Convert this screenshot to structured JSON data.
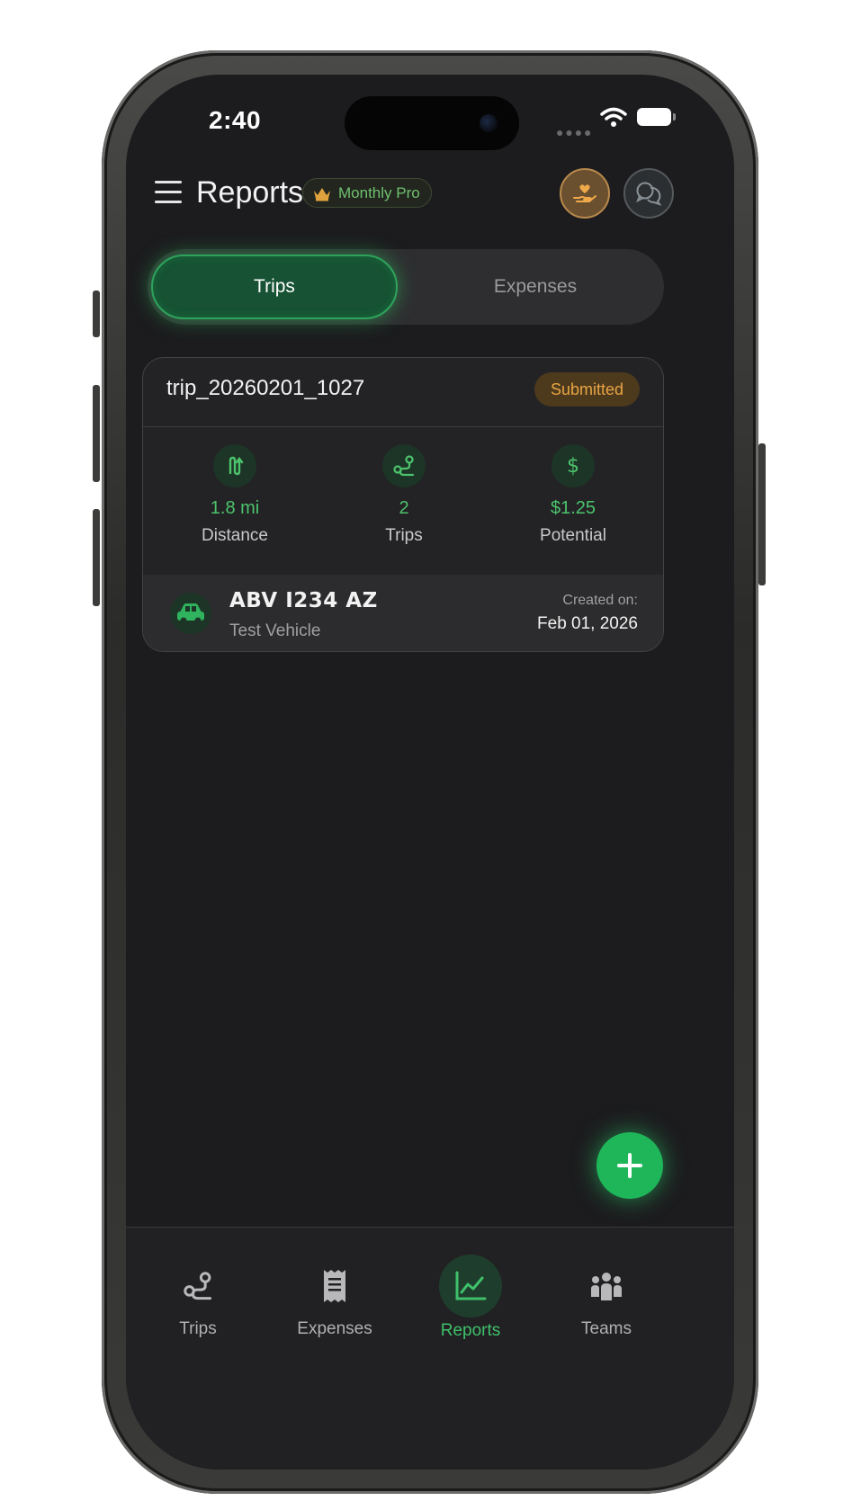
{
  "status_bar": {
    "time": "2:40"
  },
  "header": {
    "title": "Reports",
    "plan_badge": "Monthly Pro"
  },
  "segmented_control": {
    "tabs": [
      "Trips",
      "Expenses"
    ],
    "selected": "Trips"
  },
  "report_card": {
    "trip_id": "trip_20260201_1027",
    "status": "Submitted",
    "stats": [
      {
        "value": "1.8 mi",
        "label": "Distance",
        "icon": "route-icon"
      },
      {
        "value": "2",
        "label": "Trips",
        "icon": "trip-path-icon"
      },
      {
        "value": "$1.25",
        "label": "Potential",
        "icon": "dollar-icon"
      }
    ],
    "vehicle": {
      "plate": "ABV I234 AZ",
      "name": "Test Vehicle",
      "created_label": "Created on:",
      "created_date": "Feb 01, 2026"
    }
  },
  "fab": {
    "icon": "plus-icon"
  },
  "bottom_nav": {
    "items": [
      {
        "label": "Trips",
        "icon": "trip-path-icon"
      },
      {
        "label": "Expenses",
        "icon": "receipt-icon"
      },
      {
        "label": "Reports",
        "icon": "chart-icon"
      },
      {
        "label": "Teams",
        "icon": "team-icon"
      }
    ],
    "selected": "Reports"
  },
  "colors": {
    "accent": "#2ea35b",
    "accent_text": "#4cc36c",
    "status_submitted": "#e8a444",
    "background": "#1c1c1e"
  }
}
